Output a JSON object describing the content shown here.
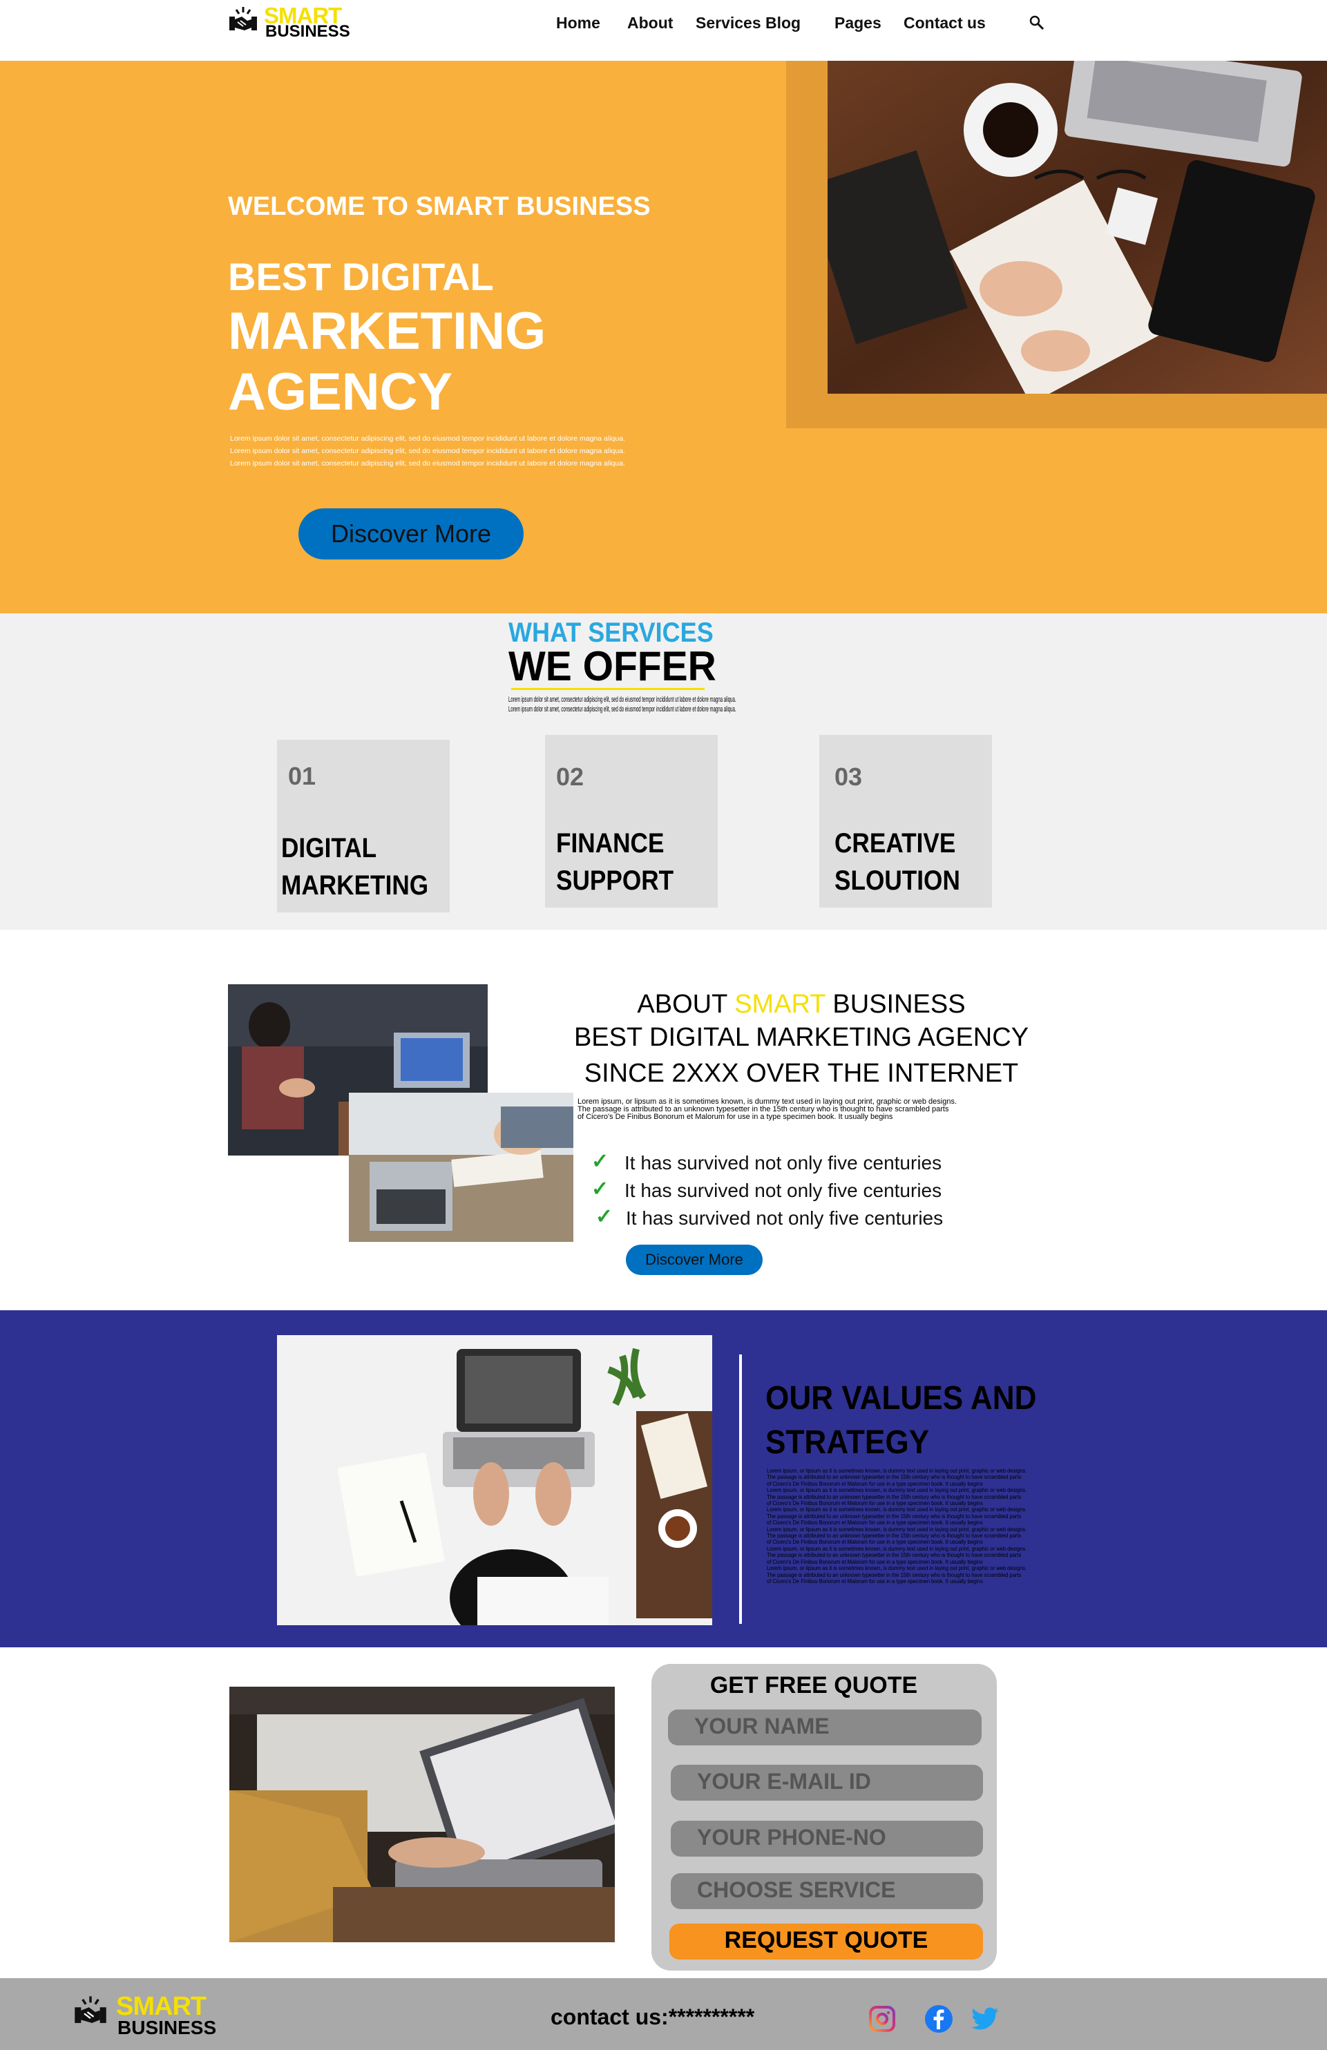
{
  "brand": {
    "smart": "SMART",
    "business": "BUSINESS"
  },
  "nav": {
    "home": "Home",
    "about": "About",
    "services": "Services",
    "blog": "Blog",
    "pages": "Pages",
    "contact": "Contact us",
    "search_icon": "search-icon"
  },
  "hero": {
    "welcome": "WELCOME TO SMART BUSINESS",
    "line1": "BEST DIGITAL",
    "line2": "MARKETING",
    "line3": "AGENCY",
    "lorem": [
      "Lorem ipsum dolor sit amet, consectetur adipiscing elit, sed do eiusmod tempor incididunt ut labore et dolore magna aliqua.",
      "Lorem ipsum dolor sit amet, consectetur adipiscing elit, sed do eiusmod tempor incididunt ut labore et dolore magna aliqua.",
      "Lorem ipsum dolor sit amet, consectetur adipiscing elit, sed do eiusmod tempor incididunt ut labore et dolore magna aliqua."
    ],
    "button": "Discover More"
  },
  "services": {
    "kicker": "WHAT SERVICES",
    "title": "WE OFFER",
    "lorem": [
      "Lorem ipsum dolor sit amet, consectetur adipiscing elit, sed do eiusmod tempor incididunt ut labore et dolore magna aliqua.",
      "Lorem ipsum dolor sit amet, consectetur adipiscing elit, sed do eiusmod tempor incididunt ut labore et dolore magna aliqua."
    ],
    "cards": [
      {
        "num": "01",
        "line1": "DIGITAL",
        "line2": "MARKETING"
      },
      {
        "num": "02",
        "line1": "FINANCE",
        "line2": "SUPPORT"
      },
      {
        "num": "03",
        "line1": "CREATIVE",
        "line2": "SLOUTION"
      }
    ]
  },
  "about": {
    "about_word": "ABOUT",
    "smart_word": "SMART",
    "business_word": "BUSINESS",
    "line2": "BEST DIGITAL MARKETING AGENCY",
    "line3": "SINCE 2XXX OVER THE INTERNET",
    "para": [
      "Lorem ipsum, or lipsum as it is sometimes known, is dummy text used in laying out print, graphic or web designs.",
      "The passage is attributed to an unknown typesetter in the 15th century who is thought to have scrambled parts",
      "of Cicero's De Finibus Bonorum et Malorum for use in a type specimen book. It usually begins"
    ],
    "checks": [
      "It has survived not only five centuries",
      "It has survived not only five centuries",
      "It has survived not only five centuries"
    ],
    "check_mark": "✓",
    "button": "Discover More"
  },
  "values": {
    "title1": "OUR VALUES AND",
    "title2": "STRATEGY",
    "para": [
      "Lorem ipsum, or lipsum as it is sometimes known, is dummy text used in laying out print, graphic or web designs.",
      "The passage is attributed to an unknown typesetter in the 15th century who is thought to have scrambled parts",
      "of Cicero's De Finibus Bonorum et Malorum for use in a type specimen book. It usually begins",
      "Lorem ipsum, or lipsum as it is sometimes known, is dummy text used in laying out print, graphic or web designs.",
      "The passage is attributed to an unknown typesetter in the 15th century who is thought to have scrambled parts",
      "of Cicero's De Finibus Bonorum et Malorum for use in a type specimen book. It usually begins",
      "Lorem ipsum, or lipsum as it is sometimes known, is dummy text used in laying out print, graphic or web designs.",
      "The passage is attributed to an unknown typesetter in the 15th century who is thought to have scrambled parts",
      "of Cicero's De Finibus Bonorum et Malorum for use in a type specimen book. It usually begins",
      "Lorem ipsum, or lipsum as it is sometimes known, is dummy text used in laying out print, graphic or web designs.",
      "The passage is attributed to an unknown typesetter in the 15th century who is thought to have scrambled parts",
      "of Cicero's De Finibus Bonorum et Malorum for use in a type specimen book. It usually begins",
      "Lorem ipsum, or lipsum as it is sometimes known, is dummy text used in laying out print, graphic or web designs.",
      "The passage is attributed to an unknown typesetter in the 15th century who is thought to have scrambled parts",
      "of Cicero's De Finibus Bonorum et Malorum for use in a type specimen book. It usually begins",
      "Lorem ipsum, or lipsum as it is sometimes known, is dummy text used in laying out print, graphic or web designs.",
      "The passage is attributed to an unknown typesetter in the 15th century who is thought to have scrambled parts",
      "of Cicero's De Finibus Bonorum et Malorum for use in a type specimen book. It usually begins"
    ]
  },
  "quote": {
    "title": "GET FREE QUOTE",
    "name": "YOUR NAME",
    "email": "YOUR E-MAIL ID",
    "phone": "YOUR PHONE-NO",
    "service": "CHOOSE SERVICE",
    "button": "REQUEST QUOTE"
  },
  "footer": {
    "contact": "contact us:**********",
    "social": [
      "instagram-icon",
      "facebook-icon",
      "twitter-icon"
    ]
  },
  "colors": {
    "hero_bg": "#f9b03c",
    "accent_yellow": "#f5e000",
    "button_blue": "#0070c0",
    "values_bg": "#2e3192",
    "quote_orange": "#f7931e",
    "footer_bg": "#a9a9a9",
    "services_kicker": "#29a8e0"
  }
}
